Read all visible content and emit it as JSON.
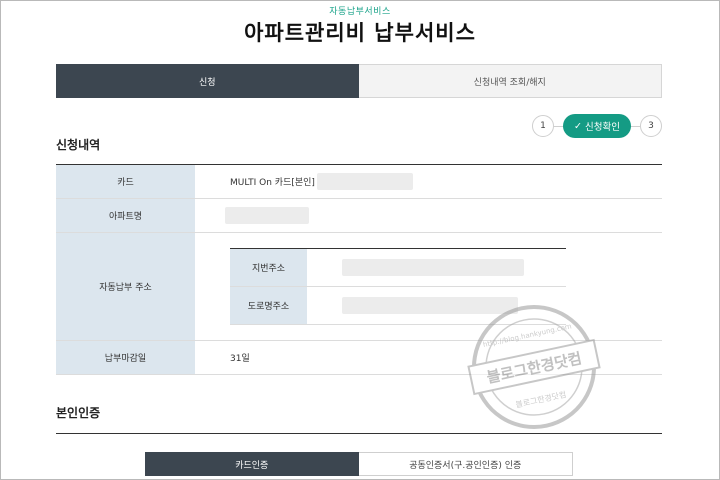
{
  "header": {
    "service_label": "자동납부서비스",
    "title": "아파트관리비 납부서비스"
  },
  "main_tabs": [
    {
      "label": "신청",
      "active": true
    },
    {
      "label": "신청내역 조회/해지",
      "active": false
    }
  ],
  "steps": {
    "step1": "1",
    "current_check": "✓",
    "current_label": "신청확인",
    "step3": "3"
  },
  "application": {
    "section_title": "신청내역",
    "card_label": "카드",
    "card_value": "MULTI On 카드[본인]",
    "apt_label": "아파트명",
    "address_label": "자동납부 주소",
    "lot_address_label": "지번주소",
    "road_address_label": "도로명주소",
    "due_day_label": "납부마감일",
    "due_day_value": "31일"
  },
  "auth": {
    "section_title": "본인인증",
    "tabs": [
      {
        "label": "카드인증",
        "active": true
      },
      {
        "label": "공동인증서(구.공인인증) 인증",
        "active": false
      }
    ]
  },
  "watermark": {
    "main_text": "블로그한경닷컴",
    "ring_top": "http://blog.hankyung.com",
    "ring_bottom": "블로그한경닷컴"
  },
  "colors": {
    "dark_tab": "#3c4650",
    "accent": "#149b84",
    "label_bg": "#dce6ee"
  }
}
